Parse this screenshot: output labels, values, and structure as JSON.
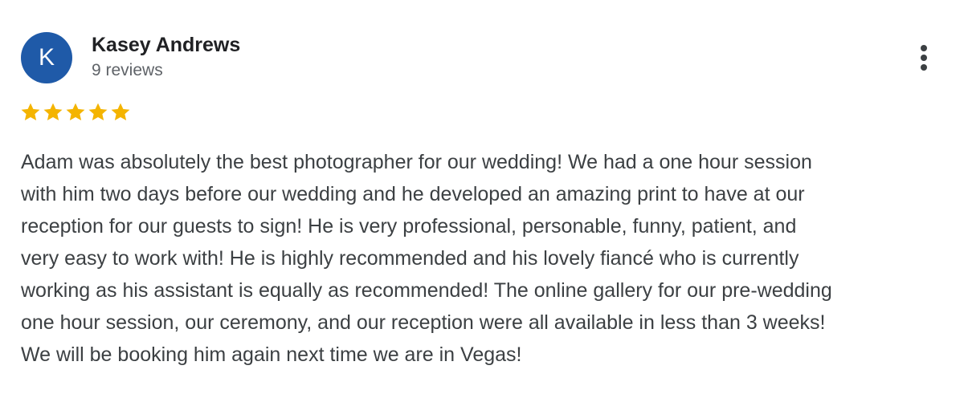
{
  "review": {
    "avatar_initial": "K",
    "reviewer_name": "Kasey Andrews",
    "review_count": "9 reviews",
    "rating": 5,
    "rating_max": 5,
    "more_icon": "more-vert-icon",
    "star_icon": "star-icon",
    "text_lines": [
      "Adam was absolutely the best photographer for our wedding! We had a one hour session",
      "with him two days before our wedding and he developed an amazing print to have at our",
      "reception for our guests to sign! He is very professional, personable, funny, patient, and",
      "very easy to work with! He is highly recommended and his lovely fiancé who is currently",
      "working as his assistant is equally as recommended! The online gallery for our pre-wedding",
      "one hour session, our ceremony, and our reception were all available in less than 3 weeks!",
      "We will be booking him again next time we are in Vegas!"
    ]
  },
  "colors": {
    "avatar_bg": "#1f5aa8",
    "star": "#f4b400",
    "name": "#202124",
    "secondary": "#5f6368",
    "body_text": "#3c4043"
  }
}
